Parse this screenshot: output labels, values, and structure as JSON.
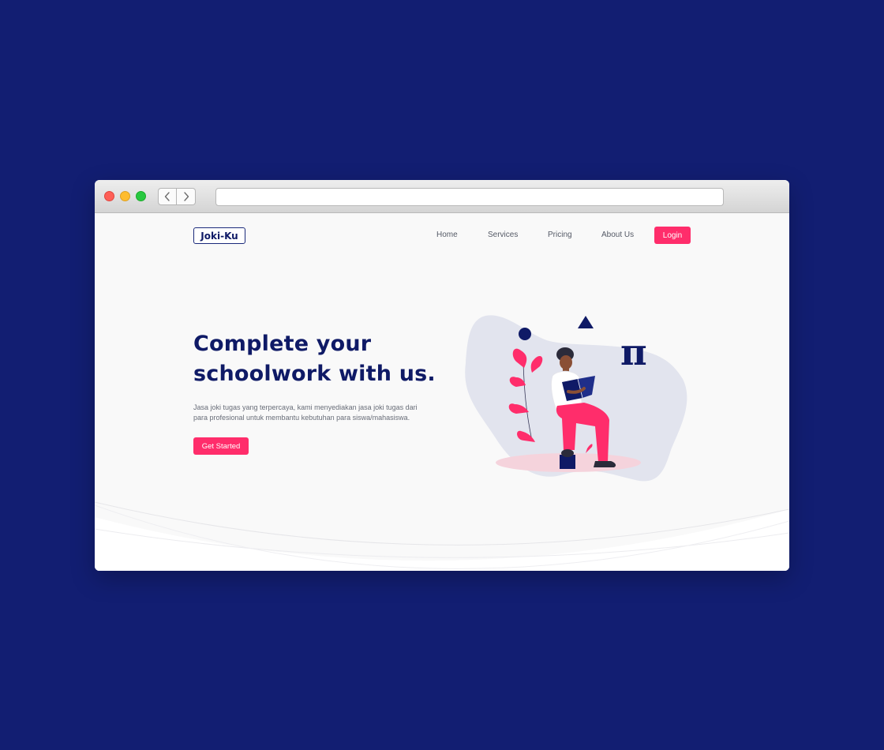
{
  "colors": {
    "background": "#121e72",
    "accent": "#ff2d6b",
    "brand": "#0f1a66",
    "page_background": "#f9f9f9"
  },
  "browser": {
    "address": ""
  },
  "nav": {
    "logo": "Joki-Ku",
    "items": [
      {
        "label": "Home"
      },
      {
        "label": "Services"
      },
      {
        "label": "Pricing"
      },
      {
        "label": "About Us"
      }
    ],
    "login_label": "Login"
  },
  "hero": {
    "title": "Complete your schoolwork with us.",
    "description": "Jasa joki tugas yang terpercaya, kami menyediakan jasa joki tugas dari para profesional untuk membantu kebutuhan para siswa/mahasiswa.",
    "cta_label": "Get Started"
  },
  "illustration": {
    "symbol": "π"
  }
}
